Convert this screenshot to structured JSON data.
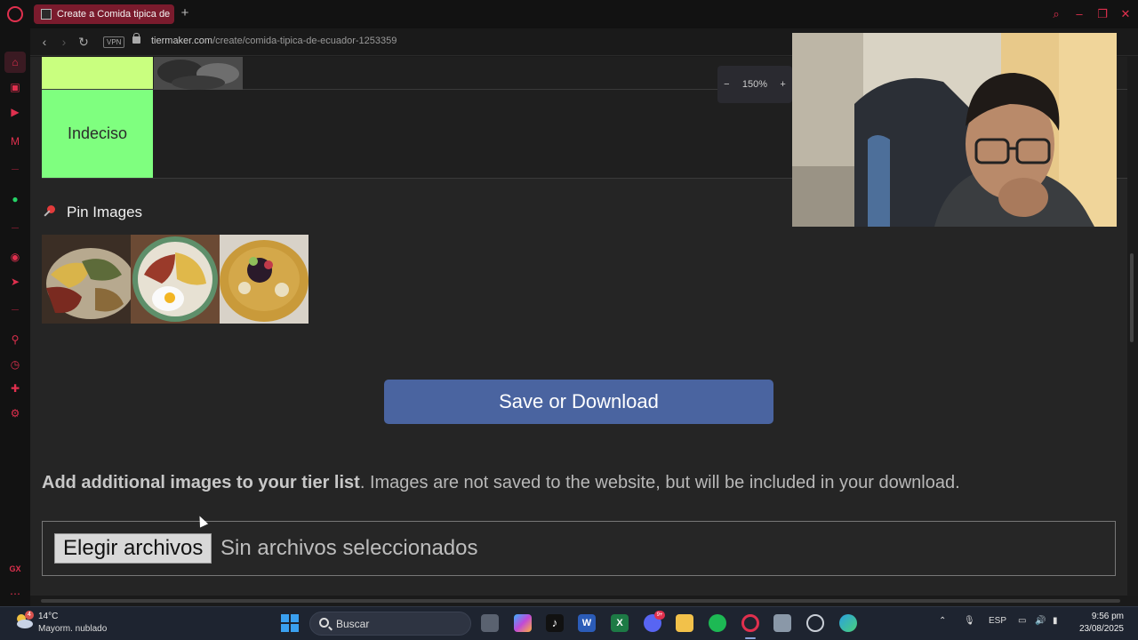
{
  "browser": {
    "tab_title": "Create a Comida tipica de",
    "tab_new_label": "+",
    "url_domain": "tiermaker.com",
    "url_path": "/create/comida-tipica-de-ecuador-1253359",
    "vpn_label": "VPN",
    "zoom_minus": "−",
    "zoom_value": "150%",
    "zoom_plus": "+",
    "sidebar_gx_label": "GX"
  },
  "tiers": [
    {
      "label": "",
      "color": "#c9ff7f"
    },
    {
      "label": "Indeciso",
      "color": "#7fff7f"
    }
  ],
  "pin_section": {
    "heading": "Pin Images",
    "image_count": 3
  },
  "save_button": {
    "label": "Save or Download"
  },
  "additional_images": {
    "bold_text": "Add additional images to your tier list",
    "rest_text": ". Images are not saved to the website, but will be included in your download."
  },
  "file_input": {
    "button_label": "Elegir archivos",
    "status_text": "Sin archivos seleccionados"
  },
  "taskbar": {
    "weather_temp": "14°C",
    "weather_desc": "Mayorm. nublado",
    "weather_badge": "4",
    "search_placeholder": "Buscar",
    "discord_badge": "9+",
    "language": "ESP",
    "time": "9:56 pm",
    "date": "23/08/2025"
  },
  "colors": {
    "accent": "#e0304e",
    "save_button": "#4a64a0",
    "page_bg": "#252525"
  }
}
